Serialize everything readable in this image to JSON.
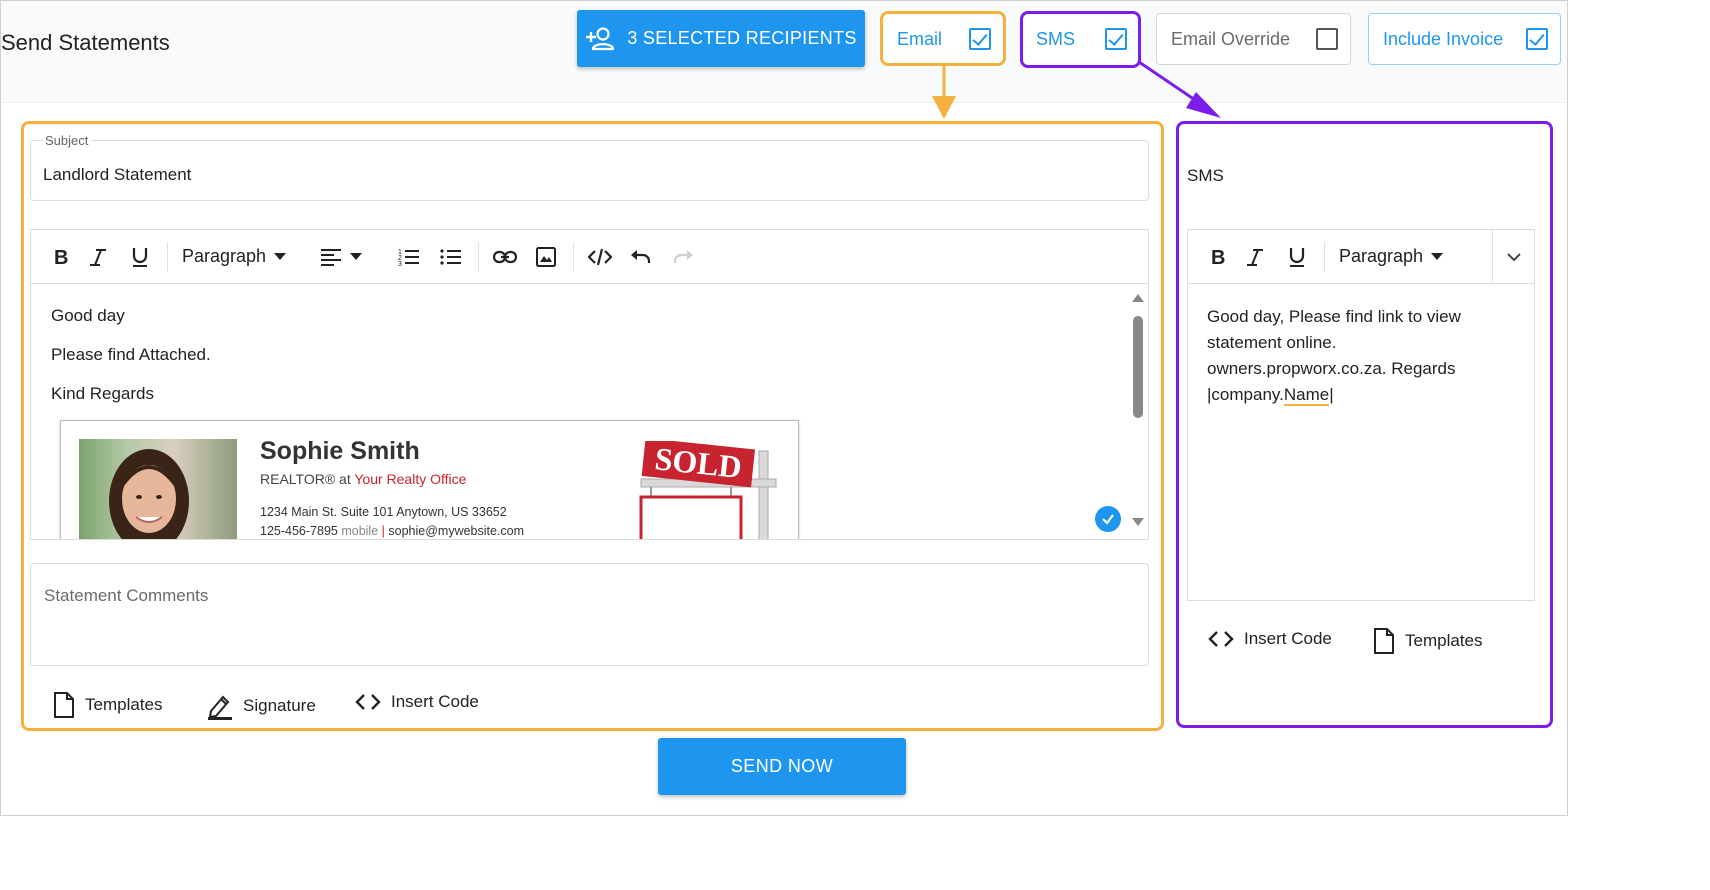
{
  "header": {
    "title": "Send Statements",
    "recipients_button": "3 SELECTED RECIPIENTS",
    "options": [
      {
        "label": "Email",
        "checked": true
      },
      {
        "label": "SMS",
        "checked": true
      },
      {
        "label": "Email Override",
        "checked": false
      },
      {
        "label": "Include Invoice",
        "checked": true
      }
    ]
  },
  "email": {
    "subject_label": "Subject",
    "subject_value": "Landlord Statement",
    "toolbar": {
      "format": "Paragraph"
    },
    "body_lines": [
      "Good day",
      "Please find Attached.",
      "Kind Regards"
    ],
    "signature": {
      "name": "Sophie Smith",
      "role_prefix": "REALTOR® at ",
      "office": "Your Realty Office",
      "address": "1234 Main St. Suite 101 Anytown, US 33652",
      "phone": "125-456-7895",
      "phone_type": "mobile",
      "email": "sophie@mywebsite.com",
      "sign_text": "SOLD"
    },
    "comments_placeholder": "Statement Comments",
    "actions": {
      "templates": "Templates",
      "signature": "Signature",
      "insert_code": "Insert Code"
    }
  },
  "sms": {
    "title": "SMS",
    "toolbar": {
      "format": "Paragraph"
    },
    "body_line1": "Good day, Please find link to view",
    "body_line2": "statement online.",
    "body_line3": "owners.propworx.co.za. Regards",
    "body_line4_prefix": "|company.",
    "body_line4_word": "Name",
    "body_line4_suffix": "|",
    "actions": {
      "insert_code": "Insert Code",
      "templates": "Templates"
    }
  },
  "send_button": "SEND NOW",
  "colors": {
    "accent": "#1e96f0",
    "highlight_email": "#f5b040",
    "highlight_sms": "#7d1ee8"
  }
}
